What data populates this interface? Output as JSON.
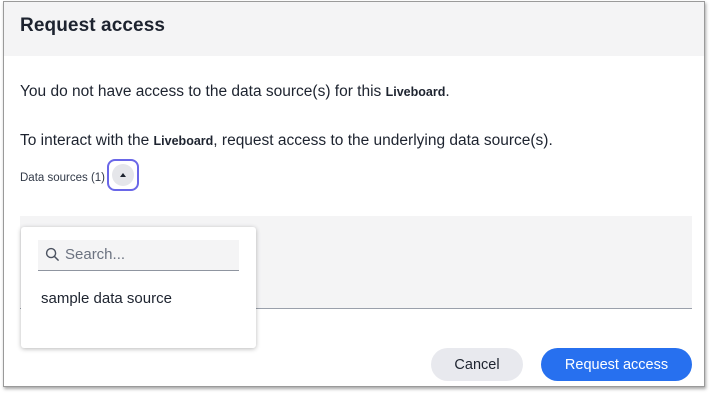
{
  "dialog": {
    "title": "Request access",
    "line1_pre": "You do not have access to the data source(s) for this ",
    "line1_obj": "Liveboard",
    "line1_post": ".",
    "line2_pre": "To interact with the ",
    "line2_obj": "Liveboard",
    "line2_post": ", request access to the underlying data source(s).",
    "data_sources_label": "Data sources (1)",
    "toggle_icon": "caret-up-icon"
  },
  "dropdown": {
    "search_placeholder": "Search...",
    "search_value": "",
    "search_icon": "search-icon",
    "items": [
      {
        "label": "sample data source"
      }
    ]
  },
  "footer": {
    "cancel_label": "Cancel",
    "request_label": "Request access"
  },
  "colors": {
    "primary": "#2770ef",
    "focus_ring": "#6a67e8",
    "header_bg": "#f4f4f5",
    "text": "#1d232f"
  }
}
